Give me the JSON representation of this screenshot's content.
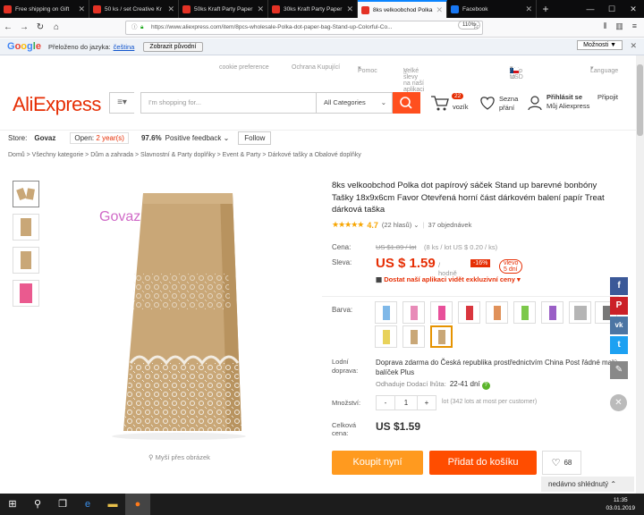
{
  "tabs": [
    {
      "label": "Free shipping on Gift",
      "active": false,
      "icon": "aliexpress-icon"
    },
    {
      "label": "50 ks / set Creative Kr",
      "active": false,
      "icon": "aliexpress-icon"
    },
    {
      "label": "50ks Kraft Party Paper",
      "active": false,
      "icon": "aliexpress-icon"
    },
    {
      "label": "30ks Kraft Party Paper",
      "active": false,
      "icon": "aliexpress-icon"
    },
    {
      "label": "8ks velkoobchod Polka",
      "active": true,
      "icon": "aliexpress-icon"
    },
    {
      "label": "Facebook",
      "active": false,
      "icon": "facebook-icon"
    }
  ],
  "browser": {
    "url": "https://www.aliexpress.com/item/8pcs-wholesale-Polka-dot-paper-bag-Stand-up-Colorful-Co...",
    "zoom": "110%"
  },
  "translate": {
    "translated_to": "Přeloženo do jazyka:",
    "language": "čeština",
    "show_original": "Zobrazit původní",
    "options": "Možnosti ▼"
  },
  "toplinks": {
    "cookie": "cookie preference",
    "buyer": "Ochrana Kupující",
    "help": "Pomoc",
    "app": "Velké slevy na naší aplikaci",
    "shipto": "Ship to",
    "currency": "/ USD",
    "language": "Language"
  },
  "header": {
    "logo": "AliExpress",
    "search_placeholder": "I'm shopping for...",
    "category": "All Categories",
    "cart_count": "22",
    "cart_label": "vozík",
    "wish_line1": "Sezna",
    "wish_line2": "přání",
    "account_line1": "Přihlásit se",
    "account_line2": "Můj Aliexpress",
    "register": "Připojit"
  },
  "store": {
    "label": "Store:",
    "name": "Govaz",
    "open_prefix": "Open:",
    "open_years": "2 year(s)",
    "feedback_pct": "97.6%",
    "feedback_label": "Positive feedback",
    "follow": "Follow"
  },
  "breadcrumb": "Domů > Všechny kategorie > Dům a zahrada > Slavnostní & Party doplňky > Event & Party > Dárkové tašky a Obalové doplňky",
  "gallery": {
    "watermark": "Govaz",
    "hint": "Myší přes obrázek",
    "thumb_colors": [
      "#c9a777",
      "#c9a777",
      "#c9a777",
      "#ea5a8f"
    ]
  },
  "product": {
    "title": "8ks velkoobchod Polka dot papírový sáček Stand up barevné bonbóny Tašky 18x9x6cm Favor Otevřená horní část dárkovém balení papír Treat dárková taška",
    "stars": "★★★★★",
    "rating": "4.7",
    "reviews": "(22 hlasů)",
    "orders": "37 objednávek",
    "price_label": "Cena:",
    "old_price": "US $1.89 / lot",
    "old_price_meta": "(8 ks / lot US $ 0.20 / ks)",
    "sale_label": "Sleva:",
    "price": "US $ 1.59",
    "unit": "/ hodně",
    "discount": "-16%",
    "days_left": "vlevo 5 dní",
    "app_promo": "Dostat naší aplikaci vidět exkluzivní ceny",
    "color_label": "Barva:",
    "swatches": [
      "#7fb8e8",
      "#e88bb8",
      "#e8509a",
      "#d9363e",
      "#e0915a",
      "#7cc84a",
      "#9a5fc6",
      "#b5b5b5",
      "#777777",
      "#e8d25a",
      "#c9a777",
      "#c9a777"
    ],
    "shipping_label_1": "Lodní",
    "shipping_label_2": "doprava:",
    "shipping_text": "Doprava zdarma do Česká republika prostřednictvím China Post řádné malý balíček Plus",
    "eta_label": "Odhaduje Dodací lhůta:",
    "eta_value": "22-41 dní",
    "qty_label": "Množství:",
    "qty_minus": "-",
    "qty_value": "1",
    "qty_plus": "+",
    "lot_info": "lot (342 lots at most per customer)",
    "total_label_1": "Celková",
    "total_label_2": "cena:",
    "total": "US $1.59",
    "buy_now": "Koupit nyní",
    "add_cart": "Přidat do košíku",
    "wishlist_count": "68"
  },
  "side": {
    "recent": "nedávno shlédnutý"
  },
  "taskbar": {
    "time": "11:35",
    "date": "03.01.2019"
  },
  "colors": {
    "accent": "#e62e04",
    "search_button": "#ff4f1e",
    "buy_now": "#ff9a1f",
    "add_cart": "#ff4d00"
  }
}
